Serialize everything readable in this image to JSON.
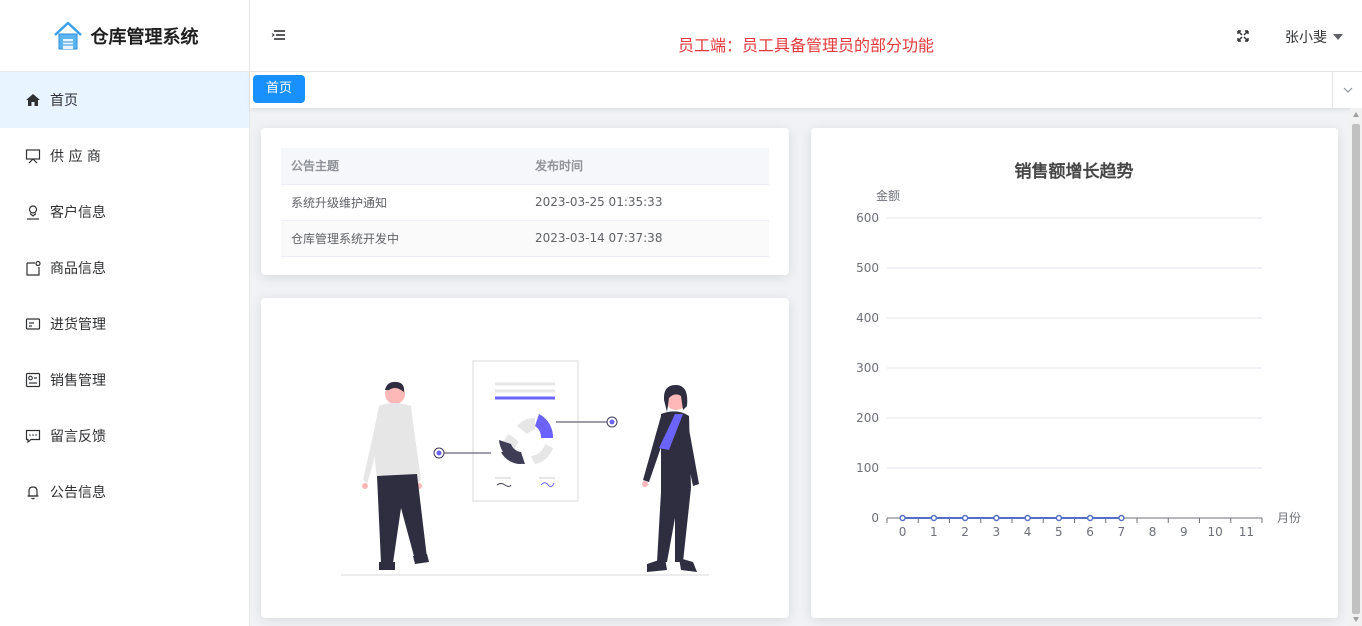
{
  "app": {
    "title": "仓库管理系统",
    "notice": "员工端：员工具备管理员的部分功能",
    "user_name": "张小斐"
  },
  "sidebar": {
    "items": [
      {
        "label": "首页",
        "icon": "home-icon",
        "active": true
      },
      {
        "label": "供 应 商",
        "icon": "easel-icon",
        "active": false
      },
      {
        "label": "客户信息",
        "icon": "user-icon",
        "active": false
      },
      {
        "label": "商品信息",
        "icon": "goods-icon",
        "active": false
      },
      {
        "label": "进货管理",
        "icon": "purchase-icon",
        "active": false
      },
      {
        "label": "销售管理",
        "icon": "sales-icon",
        "active": false
      },
      {
        "label": "留言反馈",
        "icon": "chat-icon",
        "active": false
      },
      {
        "label": "公告信息",
        "icon": "bell-icon",
        "active": false
      }
    ]
  },
  "tabs": [
    {
      "label": "首页",
      "active": true
    }
  ],
  "notice_table": {
    "headers": [
      "公告主题",
      "发布时间"
    ],
    "rows": [
      [
        "系统升级维护通知",
        "2023-03-25 01:35:33"
      ],
      [
        "仓库管理系统开发中",
        "2023-03-14 07:37:38"
      ]
    ]
  },
  "colors": {
    "accent": "#1890ff",
    "notice_red": "#e4393c",
    "illustration_purple": "#6c63ff",
    "line_series": "#5470c6"
  },
  "chart_data": {
    "type": "line",
    "title": "销售额增长趋势",
    "ylabel": "金额",
    "xlabel": "月份",
    "x": [
      0,
      1,
      2,
      3,
      4,
      5,
      6,
      7,
      8,
      9,
      10,
      11
    ],
    "series": [
      {
        "values": [
          0,
          0,
          0,
          0,
          0,
          0,
          0,
          0
        ]
      }
    ],
    "ylim": [
      0,
      600
    ],
    "yticks": [
      0,
      100,
      200,
      300,
      400,
      500,
      600
    ],
    "grid": true
  }
}
